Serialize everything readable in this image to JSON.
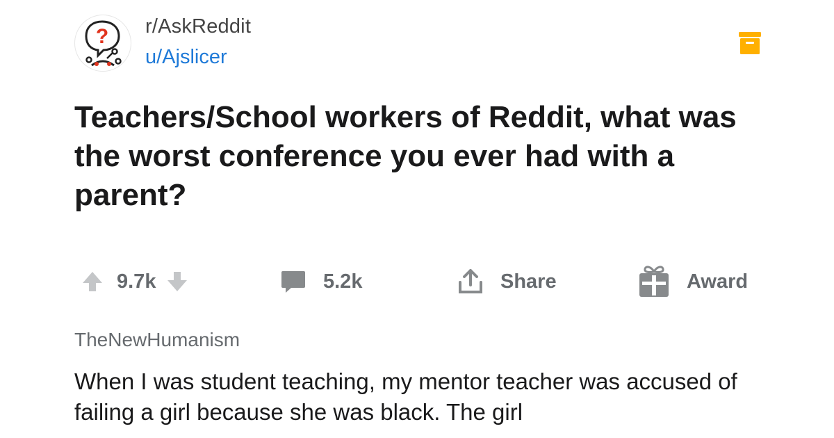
{
  "post": {
    "subreddit": "r/AskReddit",
    "author": "u/Ajslicer",
    "title": "Teachers/School workers of Reddit, what was the worst conference you ever had with a parent?"
  },
  "actions": {
    "upvotes": "9.7k",
    "comments": "5.2k",
    "share_label": "Share",
    "award_label": "Award"
  },
  "comment": {
    "author": "TheNewHumanism",
    "text": "When I was student teaching, my mentor teacher was accused of failing a girl because she was black. The girl"
  },
  "colors": {
    "accent_link": "#1f7ad8",
    "archive_icon": "#ffb000",
    "icon_gray": "#878a8c",
    "text_primary": "#1a1a1b"
  },
  "icons": [
    "askreddit-logo-icon",
    "archive-icon",
    "upvote-arrow-icon",
    "downvote-arrow-icon",
    "comment-bubble-icon",
    "share-icon",
    "gift-icon"
  ]
}
